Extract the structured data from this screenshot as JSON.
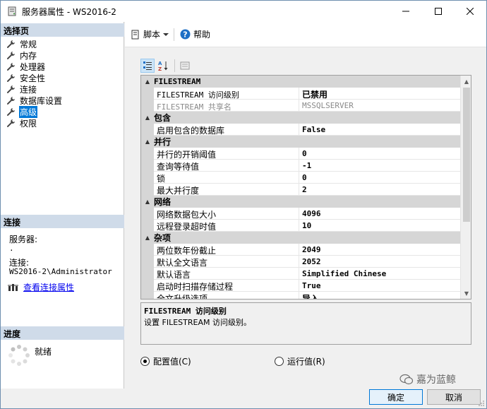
{
  "window": {
    "title": "服务器属性 - WS2016-2"
  },
  "left": {
    "select_page_header": "选择页",
    "pages": [
      {
        "label": "常规"
      },
      {
        "label": "内存"
      },
      {
        "label": "处理器"
      },
      {
        "label": "安全性"
      },
      {
        "label": "连接"
      },
      {
        "label": "数据库设置"
      },
      {
        "label": "高级"
      },
      {
        "label": "权限"
      }
    ],
    "connection_header": "连接",
    "server_label": "服务器:",
    "server_value": ".",
    "connection_label": "连接:",
    "connection_value": "WS2016-2\\Administrator",
    "view_props_link": "查看连接属性",
    "progress_header": "进度",
    "progress_status": "就绪"
  },
  "toolbar": {
    "script_label": "脚本",
    "help_label": "帮助"
  },
  "grid": {
    "categories": [
      {
        "name": "FILESTREAM",
        "rows": [
          {
            "name": "FILESTREAM 访问级别",
            "value": "已禁用"
          },
          {
            "name": "FILESTREAM 共享名",
            "value": "MSSQLSERVER"
          }
        ]
      },
      {
        "name": "包含",
        "rows": [
          {
            "name": "启用包含的数据库",
            "value": "False"
          }
        ]
      },
      {
        "name": "并行",
        "rows": [
          {
            "name": "并行的开销阈值",
            "value": "0"
          },
          {
            "name": "查询等待值",
            "value": "-1"
          },
          {
            "name": "锁",
            "value": "0"
          },
          {
            "name": "最大并行度",
            "value": "2"
          }
        ]
      },
      {
        "name": "网络",
        "rows": [
          {
            "name": "网络数据包大小",
            "value": "4096"
          },
          {
            "name": "远程登录超时值",
            "value": "10"
          }
        ]
      },
      {
        "name": "杂项",
        "rows": [
          {
            "name": "两位数年份截止",
            "value": "2049"
          },
          {
            "name": "默认全文语言",
            "value": "2052"
          },
          {
            "name": "默认语言",
            "value": "Simplified Chinese"
          },
          {
            "name": "启动时扫描存储过程",
            "value": "True"
          },
          {
            "name": "全文升级选项",
            "value": "导入"
          }
        ]
      }
    ]
  },
  "description": {
    "title": "FILESTREAM 访问级别",
    "body": "设置 FILESTREAM 访问级别。"
  },
  "radios": {
    "configured": "配置值(C)",
    "running": "运行值(R)"
  },
  "buttons": {
    "ok": "确定",
    "cancel": "取消"
  },
  "watermark": "嘉为蓝鲸"
}
